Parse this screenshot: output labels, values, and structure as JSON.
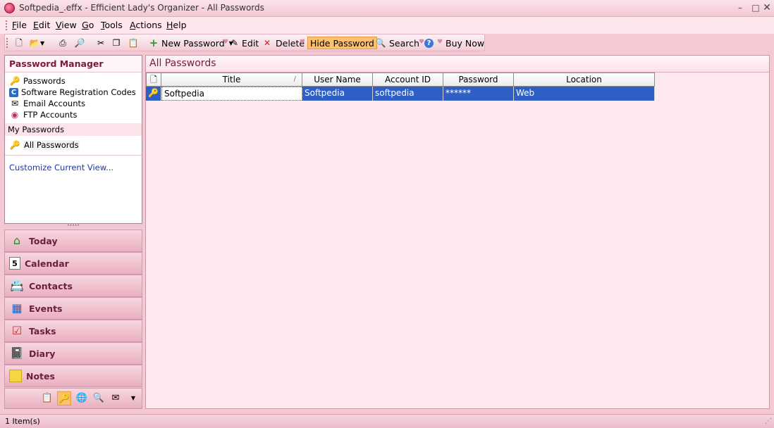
{
  "window": {
    "title": "Softpedia_.effx - Efficient Lady's Organizer - All Passwords"
  },
  "menu": [
    "File",
    "Edit",
    "View",
    "Go",
    "Tools",
    "Actions",
    "Help"
  ],
  "toolbar": {
    "new_password": "New Password",
    "edit": "Edit",
    "delete": "Delete",
    "hide_password": "Hide Password",
    "search": "Search",
    "buy_now": "Buy Now"
  },
  "sidebar": {
    "header": "Password Manager",
    "items": [
      {
        "label": "Passwords",
        "icon": "key-icon"
      },
      {
        "label": "Software Registration Codes",
        "icon": "c-badge-icon"
      },
      {
        "label": "Email Accounts",
        "icon": "email-icon"
      },
      {
        "label": "FTP Accounts",
        "icon": "ftp-icon"
      }
    ],
    "group_label": "My Passwords",
    "selected_view": "All Passwords",
    "customize_link": "Customize Current View..."
  },
  "nav_buttons": [
    {
      "label": "Today",
      "icon": "house-icon"
    },
    {
      "label": "Calendar",
      "icon": "calendar-icon"
    },
    {
      "label": "Contacts",
      "icon": "contact-card-icon"
    },
    {
      "label": "Events",
      "icon": "events-icon"
    },
    {
      "label": "Tasks",
      "icon": "checklist-icon"
    },
    {
      "label": "Diary",
      "icon": "diary-icon"
    },
    {
      "label": "Notes",
      "icon": "sticky-note-icon"
    }
  ],
  "main": {
    "title": "All Passwords",
    "columns": [
      "Title",
      "User Name",
      "Account ID",
      "Password",
      "Location"
    ],
    "rows": [
      {
        "title": "Softpedia",
        "user_name": "Softpedia",
        "account_id": "softpedia",
        "password": "******",
        "location": "Web"
      }
    ]
  },
  "status": {
    "text": "1 Item(s)"
  },
  "colors": {
    "accent": "#7a1a3a",
    "selection": "#2f5fc4",
    "highlight": "#fbc070",
    "background": "#fde8ed"
  }
}
